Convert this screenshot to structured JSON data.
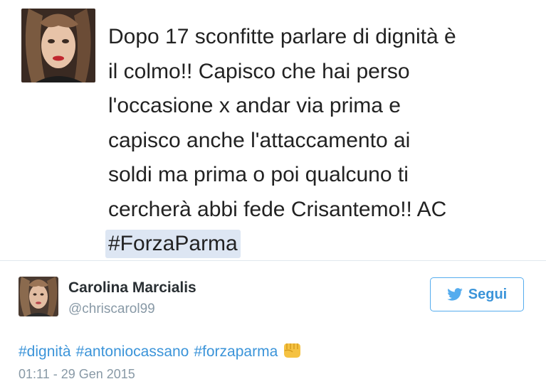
{
  "quoted_tweet": {
    "lines": [
      "Dopo 17 sconfitte parlare di dignità è",
      "il colmo!! Capisco che hai perso",
      "l'occasione x andar via prima e",
      "capisco anche l'attaccamento ai",
      "soldi ma prima o poi qualcuno ti",
      "cercherà abbi fede Crisantemo!! AC"
    ],
    "hashtag": "#ForzaParma"
  },
  "author": {
    "name": "Carolina Marcialis",
    "handle": "@chriscarol99"
  },
  "follow_button": {
    "label": "Segui",
    "icon": "twitter-bird-icon"
  },
  "tweet": {
    "hashtags": [
      "#dignità",
      "#antoniocassano",
      "#forzaparma"
    ],
    "emoji": "fist-emoji-icon",
    "timestamp": "01:11 - 29 Gen 2015"
  },
  "colors": {
    "link": "#3b94d9",
    "button_border": "#55acee",
    "muted": "#8899a6",
    "hashtag_highlight": "#dde6f3"
  }
}
